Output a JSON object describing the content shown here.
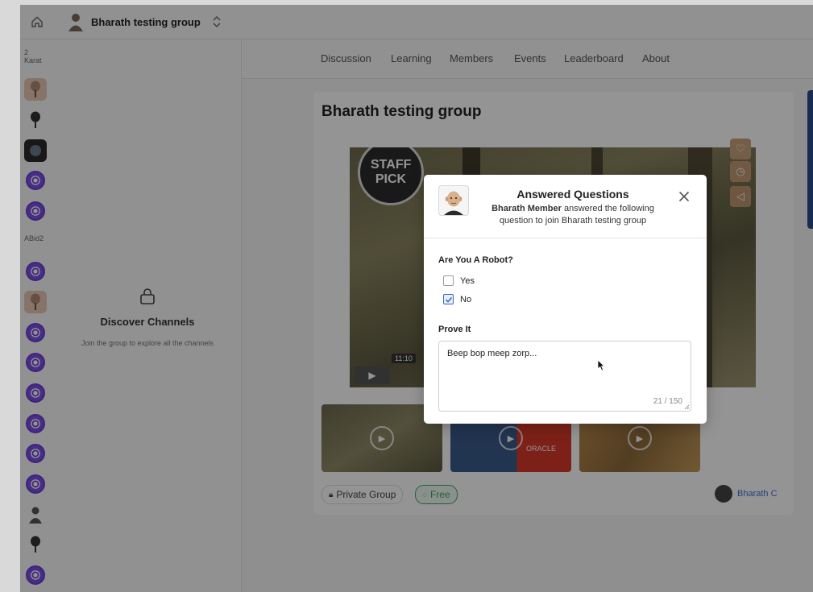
{
  "app": {
    "group_name": "Bharath testing group",
    "rail_broken_labels": [
      "2 Karat",
      "ABid2"
    ],
    "channels": {
      "discover_title": "Discover Channels",
      "discover_hint": "Join the group to explore all the channels"
    },
    "tabs": [
      "Discussion",
      "Learning",
      "Members",
      "Events",
      "Leaderboard",
      "About"
    ],
    "card": {
      "title": "Bharath testing group",
      "staff_pick": "STAFF PICK",
      "video_time": "11:10",
      "thumb_brand": "ORACLE",
      "badge_private": "Private Group",
      "badge_free": "Free",
      "host_name": "Bharath C"
    }
  },
  "modal": {
    "title": "Answered Questions",
    "subtitle_name": "Bharath Member",
    "subtitle_rest": " answered the following question to join Bharath testing group",
    "question1": {
      "label": "Are You A Robot?",
      "options": [
        {
          "label": "Yes",
          "checked": false
        },
        {
          "label": "No",
          "checked": true
        }
      ]
    },
    "question2": {
      "label": "Prove It",
      "answer": "Beep bop meep zorp...",
      "counter": "21 / 150"
    }
  },
  "colors": {
    "accent_blue": "#3b67c9",
    "rail_purple": "#6a3fd6",
    "free_green": "#3aa56b"
  }
}
